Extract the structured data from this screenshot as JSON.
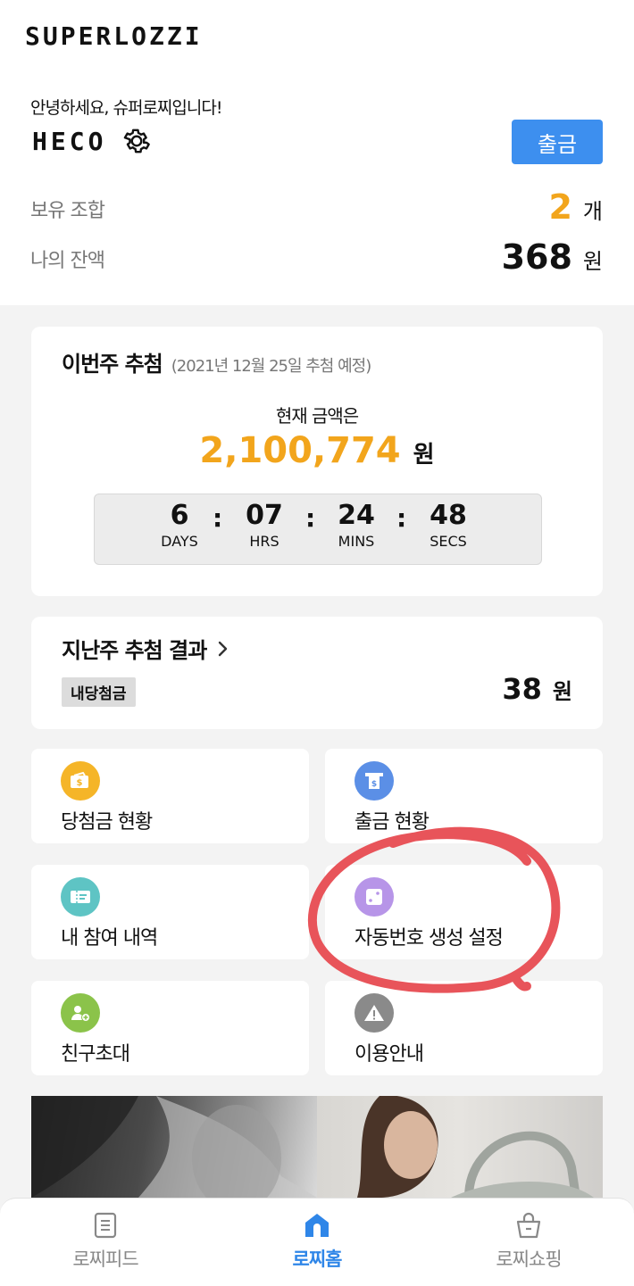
{
  "app": {
    "logo": "SUPERLOZZI"
  },
  "profile": {
    "greeting": "안녕하세요, 슈퍼로찌입니다!",
    "nickname": "HECO",
    "withdraw_button": "출금"
  },
  "stats": {
    "combos_label": "보유 조합",
    "combos_value": "2",
    "combos_unit": "개",
    "balance_label": "나의 잔액",
    "balance_value": "368",
    "balance_unit": "원"
  },
  "this_week": {
    "title": "이번주 추첨",
    "subtitle": "(2021년 12월 25일 추첨 예정)",
    "current_label": "현재 금액은",
    "amount": "2,100,774",
    "amount_unit": "원",
    "countdown": {
      "days": "6",
      "days_label": "DAYS",
      "hrs": "07",
      "hrs_label": "HRS",
      "mins": "24",
      "mins_label": "MINS",
      "secs": "48",
      "secs_label": "SECS"
    }
  },
  "last_week": {
    "title": "지난주 추첨 결과",
    "badge": "내당첨금",
    "value": "38",
    "unit": "원"
  },
  "menu": [
    {
      "label": "당첨금 현황",
      "icon": "wallet-icon",
      "color": "#f5b528"
    },
    {
      "label": "출금 현황",
      "icon": "atm-withdraw-icon",
      "color": "#5b8fe6"
    },
    {
      "label": "내 참여 내역",
      "icon": "ticket-icon",
      "color": "#5ec4c4"
    },
    {
      "label": "자동번호 생성 설정",
      "icon": "dice-icon",
      "color": "#b795e8"
    },
    {
      "label": "친구초대",
      "icon": "add-friend-icon",
      "color": "#8bc34a"
    },
    {
      "label": "이용안내",
      "icon": "warning-icon",
      "color": "#8a8a8a"
    }
  ],
  "bottom_nav": [
    {
      "label": "로찌피드",
      "icon": "feed-icon",
      "active": false
    },
    {
      "label": "로찌홈",
      "icon": "home-icon",
      "active": true
    },
    {
      "label": "로찌쇼핑",
      "icon": "shopping-basket-icon",
      "active": false
    }
  ],
  "colors": {
    "accent": "#3d8fef",
    "highlight": "#f2a51c",
    "annotation": "#e8545a"
  }
}
